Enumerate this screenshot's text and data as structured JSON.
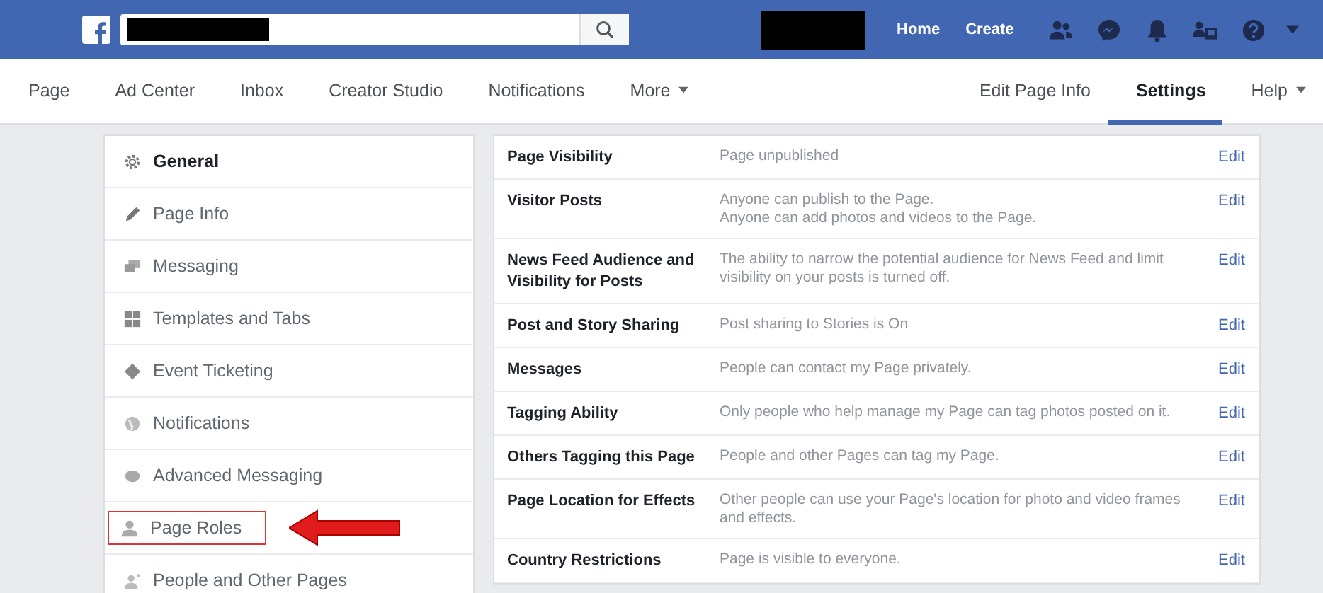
{
  "top_bar": {
    "links": [
      "Home",
      "Create"
    ]
  },
  "nav": {
    "left": [
      {
        "label": "Page",
        "selected": false,
        "dropdown": false
      },
      {
        "label": "Ad Center",
        "selected": false,
        "dropdown": false
      },
      {
        "label": "Inbox",
        "selected": false,
        "dropdown": false
      },
      {
        "label": "Creator Studio",
        "selected": false,
        "dropdown": false
      },
      {
        "label": "Notifications",
        "selected": false,
        "dropdown": false
      },
      {
        "label": "More",
        "selected": false,
        "dropdown": true
      }
    ],
    "right": [
      {
        "label": "Edit Page Info",
        "selected": false,
        "dropdown": false
      },
      {
        "label": "Settings",
        "selected": true,
        "dropdown": false
      },
      {
        "label": "Help",
        "selected": false,
        "dropdown": true
      }
    ]
  },
  "sidebar": {
    "items": [
      {
        "label": "General",
        "selected": true,
        "highlighted": false
      },
      {
        "label": "Page Info",
        "selected": false,
        "highlighted": false
      },
      {
        "label": "Messaging",
        "selected": false,
        "highlighted": false
      },
      {
        "label": "Templates and Tabs",
        "selected": false,
        "highlighted": false
      },
      {
        "label": "Event Ticketing",
        "selected": false,
        "highlighted": false
      },
      {
        "label": "Notifications",
        "selected": false,
        "highlighted": false
      },
      {
        "label": "Advanced Messaging",
        "selected": false,
        "highlighted": false
      },
      {
        "label": "Page Roles",
        "selected": false,
        "highlighted": true
      },
      {
        "label": "People and Other Pages",
        "selected": false,
        "highlighted": false
      }
    ]
  },
  "settings": {
    "rows": [
      {
        "label": "Page Visibility",
        "value": [
          "Page unpublished"
        ],
        "action": "Edit"
      },
      {
        "label": "Visitor Posts",
        "value": [
          "Anyone can publish to the Page.",
          "Anyone can add photos and videos to the Page."
        ],
        "action": "Edit"
      },
      {
        "label": "News Feed Audience and Visibility for Posts",
        "value": [
          "The ability to narrow the potential audience for News Feed and limit visibility on your posts is turned off."
        ],
        "action": "Edit"
      },
      {
        "label": "Post and Story Sharing",
        "value": [
          "Post sharing to Stories is On"
        ],
        "action": "Edit"
      },
      {
        "label": "Messages",
        "value": [
          "People can contact my Page privately."
        ],
        "action": "Edit"
      },
      {
        "label": "Tagging Ability",
        "value": [
          "Only people who help manage my Page can tag photos posted on it."
        ],
        "action": "Edit"
      },
      {
        "label": "Others Tagging this Page",
        "value": [
          "People and other Pages can tag my Page."
        ],
        "action": "Edit"
      },
      {
        "label": "Page Location for Effects",
        "value": [
          "Other people can use your Page's location for photo and video frames and effects."
        ],
        "action": "Edit"
      },
      {
        "label": "Country Restrictions",
        "value": [
          "Page is visible to everyone."
        ],
        "action": "Edit"
      }
    ]
  }
}
